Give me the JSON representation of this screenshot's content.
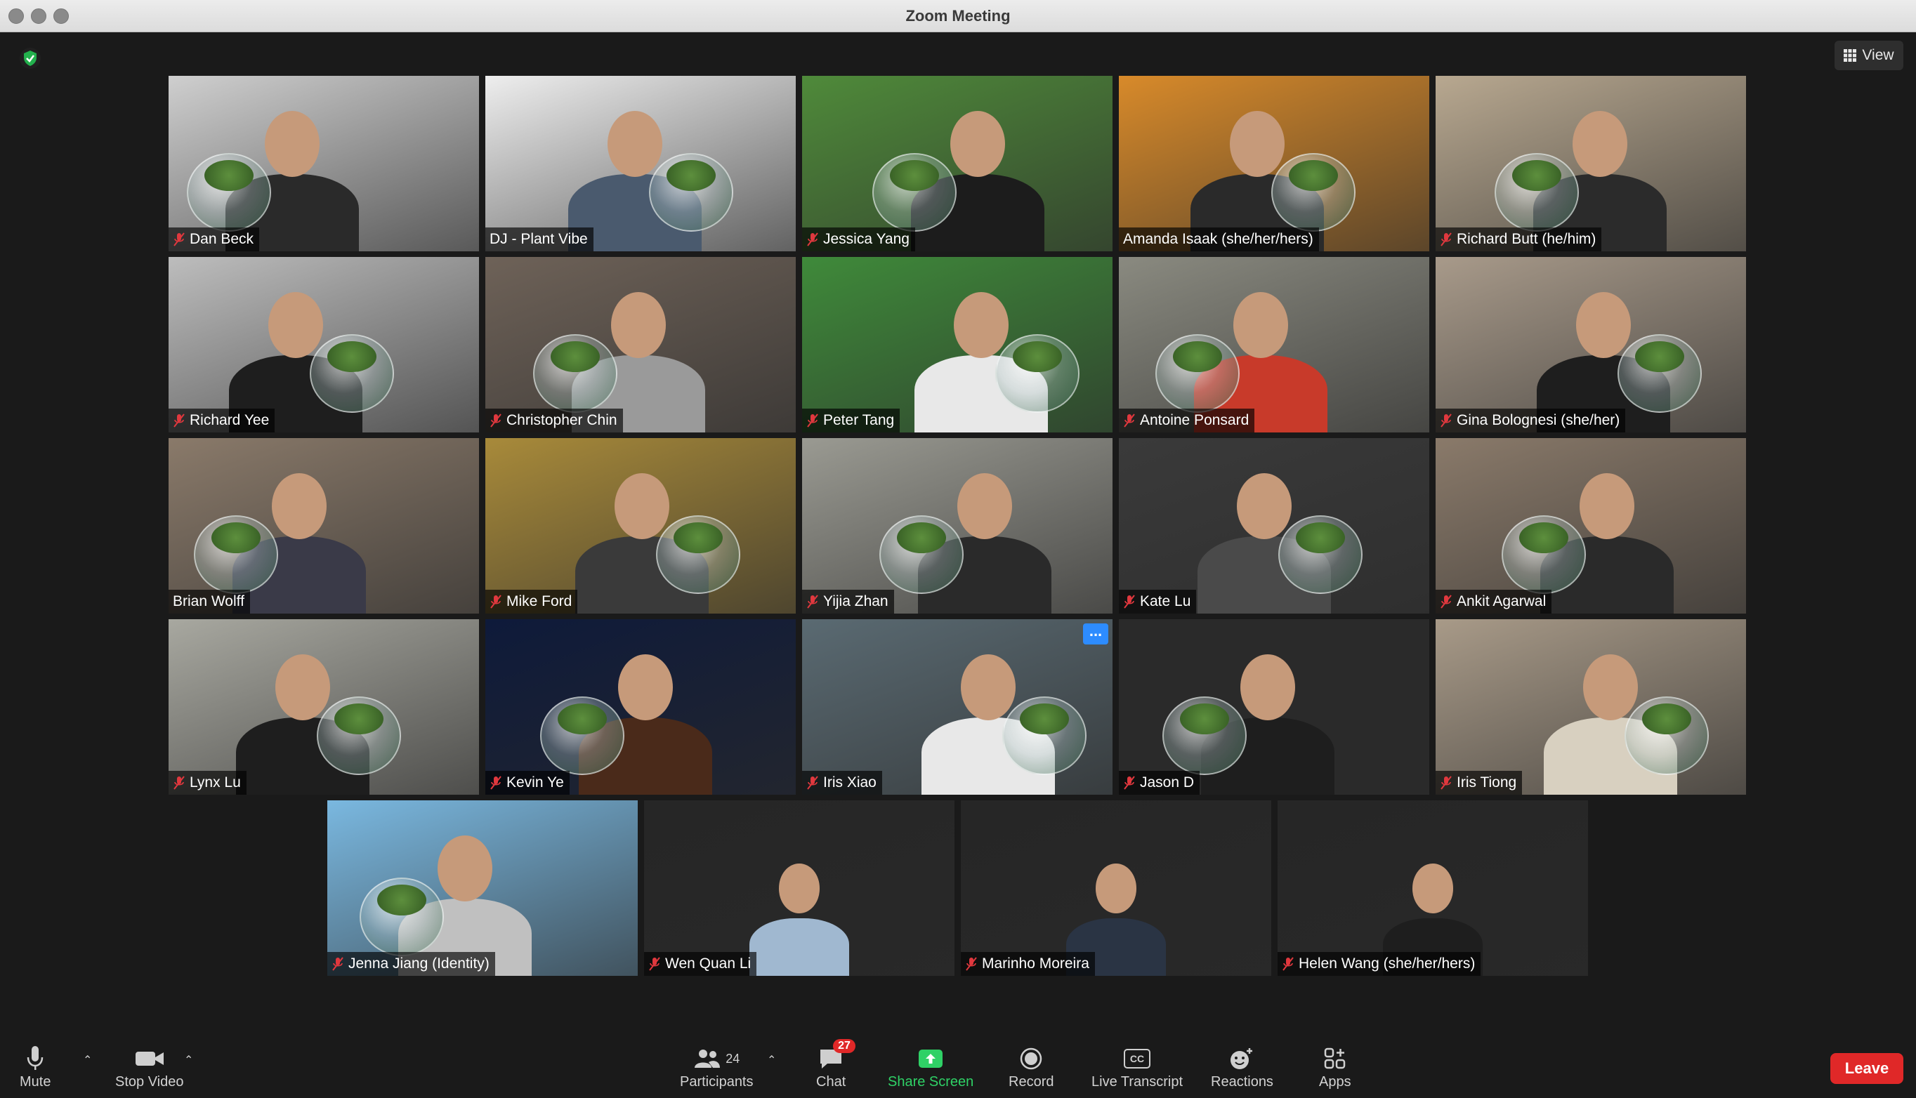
{
  "window": {
    "title": "Zoom Meeting"
  },
  "top": {
    "view_label": "View"
  },
  "participants": [
    {
      "name": "Dan Beck",
      "muted": true,
      "bg": "#cfcfcf",
      "shirt": "#2a2a2a"
    },
    {
      "name": "DJ - Plant Vibe",
      "muted": false,
      "bg": "#eeeeee",
      "shirt": "#4a5a6e"
    },
    {
      "name": "Jessica Yang",
      "muted": true,
      "bg": "#4f8a3a",
      "shirt": "#1c1c1c"
    },
    {
      "name": "Amanda Isaak (she/her/hers)",
      "muted": false,
      "bg": "#d88a2a",
      "shirt": "#2a2a2a",
      "active": true
    },
    {
      "name": "Richard Butt (he/him)",
      "muted": true,
      "bg": "#b8a890",
      "shirt": "#2b2b2b"
    },
    {
      "name": "Richard Yee",
      "muted": true,
      "bg": "#bdbdbd",
      "shirt": "#1e1e1e"
    },
    {
      "name": "Christopher Chin",
      "muted": true,
      "bg": "#6e6258",
      "shirt": "#9a9a9a"
    },
    {
      "name": "Peter Tang",
      "muted": true,
      "bg": "#3f8a3a",
      "shirt": "#e8e8e8"
    },
    {
      "name": "Antoine Ponsard",
      "muted": true,
      "bg": "#8a8a80",
      "shirt": "#c83a2a"
    },
    {
      "name": "Gina Bolognesi (she/her)",
      "muted": true,
      "bg": "#a89a8a",
      "shirt": "#1e1e1e"
    },
    {
      "name": "Brian Wolff",
      "muted": false,
      "bg": "#8a7a6a",
      "shirt": "#3a3a48"
    },
    {
      "name": "Mike Ford",
      "muted": true,
      "bg": "#a88a3a",
      "shirt": "#3a3a3a"
    },
    {
      "name": "Yijia Zhan",
      "muted": true,
      "bg": "#9a9a92",
      "shirt": "#2a2a2a"
    },
    {
      "name": "Kate Lu",
      "muted": true,
      "bg": "#3a3a3a",
      "shirt": "#4a4a4a"
    },
    {
      "name": "Ankit Agarwal",
      "muted": true,
      "bg": "#8a7a6a",
      "shirt": "#2a2a2a"
    },
    {
      "name": "Lynx Lu",
      "muted": true,
      "bg": "#a8a8a0",
      "shirt": "#1e1e1e"
    },
    {
      "name": "Kevin Ye",
      "muted": true,
      "bg": "#0e1a3a",
      "shirt": "#4a2a1a"
    },
    {
      "name": "Iris Xiao",
      "muted": true,
      "bg": "#5a6a72",
      "shirt": "#e8e8e8",
      "more": true
    },
    {
      "name": "Jason D",
      "muted": true,
      "bg": "#2a2a2a",
      "shirt": "#1e1e1e"
    },
    {
      "name": "Iris Tiong",
      "muted": true,
      "bg": "#a89a88",
      "shirt": "#d8d0c0"
    },
    {
      "name": "Jenna Jiang (Identity)",
      "muted": true,
      "bg": "#7ab8e0",
      "shirt": "#c0c0c0"
    },
    {
      "name": "Wen Quan Li",
      "muted": true,
      "bg": "#262626",
      "shirt": "#a0b8d0"
    },
    {
      "name": "Marinho Moreira",
      "muted": true,
      "bg": "#262626",
      "shirt": "#2a3444"
    },
    {
      "name": "Helen Wang (she/her/hers)",
      "muted": true,
      "bg": "#262626",
      "shirt": "#1e1e1e"
    }
  ],
  "more_label": "...",
  "toolbar": {
    "mute_label": "Mute",
    "stop_video_label": "Stop Video",
    "participants_label": "Participants",
    "participants_count": "24",
    "chat_label": "Chat",
    "chat_badge": "27",
    "share_label": "Share Screen",
    "record_label": "Record",
    "transcript_label": "Live Transcript",
    "transcript_icon_text": "CC",
    "reactions_label": "Reactions",
    "apps_label": "Apps",
    "leave_label": "Leave"
  }
}
